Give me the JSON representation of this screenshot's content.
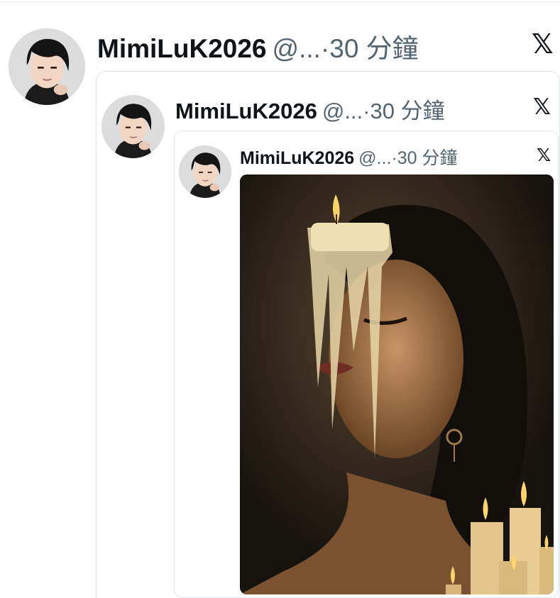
{
  "tweets": [
    {
      "name": "MimiLuK2026",
      "handle": "@...",
      "separator": "·",
      "time": "30 分鐘",
      "x_icon": "x-logo-icon"
    },
    {
      "name": "MimiLuK2026",
      "handle": "@...",
      "separator": "·",
      "time": "30 分鐘",
      "x_icon": "x-logo-icon"
    },
    {
      "name": "MimiLuK2026",
      "handle": "@...",
      "separator": "·",
      "time": "30 分鐘",
      "x_icon": "x-logo-icon"
    }
  ],
  "x_glyph": "𝕏",
  "colors": {
    "text": "#0f1419",
    "secondary": "#536471",
    "border": "#e1e5e8"
  }
}
